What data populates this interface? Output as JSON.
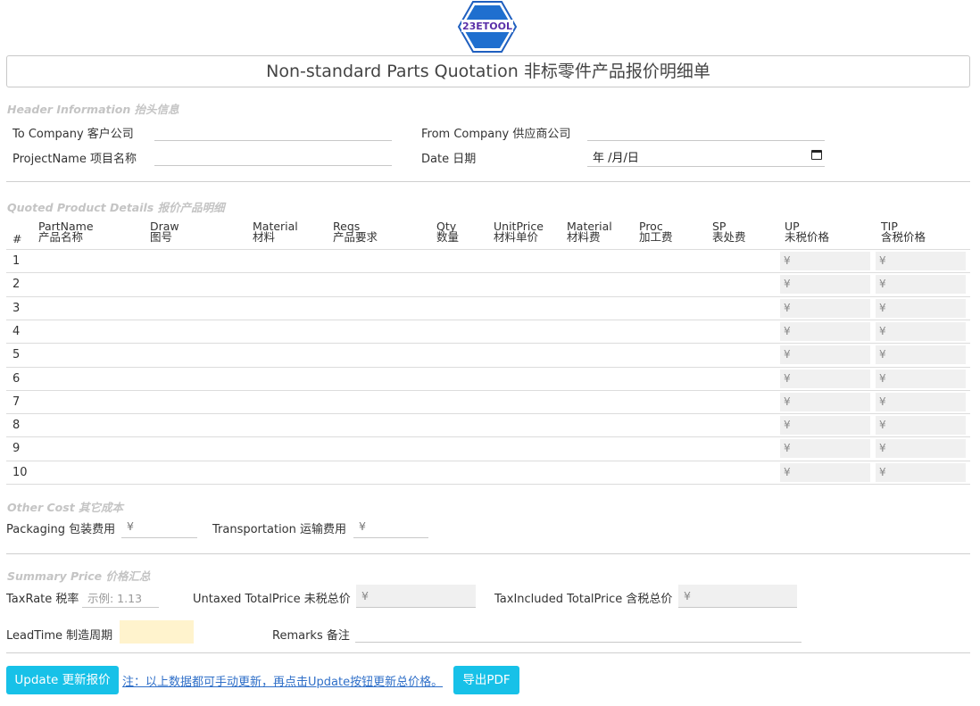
{
  "logo": {
    "text": "23ETOOL"
  },
  "title": "Non-standard Parts Quotation 非标零件产品报价明细单",
  "header_section": {
    "label": "Header Information 抬头信息",
    "to_company": "To Company 客户公司",
    "from_company": "From Company 供应商公司",
    "project_name": "ProjectName 项目名称",
    "date_label": "Date 日期",
    "date_value": "年 /月/日"
  },
  "details_section": {
    "label": "Quoted Product Details 报价产品明细",
    "columns": [
      {
        "en": "#",
        "zh": ""
      },
      {
        "en": "PartName",
        "zh": "产品名称"
      },
      {
        "en": "Draw",
        "zh": "图号"
      },
      {
        "en": "Material",
        "zh": "材料"
      },
      {
        "en": "Reqs",
        "zh": "产品要求"
      },
      {
        "en": "Qty",
        "zh": "数量"
      },
      {
        "en": "UnitPrice",
        "zh": "材料单价"
      },
      {
        "en": "Material",
        "zh": "材料费"
      },
      {
        "en": "Proc",
        "zh": "加工费"
      },
      {
        "en": "SP",
        "zh": "表处费"
      },
      {
        "en": "UP",
        "zh": "未税价格"
      },
      {
        "en": "TIP",
        "zh": "含税价格"
      }
    ],
    "rows": [
      "1",
      "2",
      "3",
      "4",
      "5",
      "6",
      "7",
      "8",
      "9",
      "10"
    ],
    "currency": "¥"
  },
  "other_cost": {
    "label": "Other Cost 其它成本",
    "packaging": "Packaging 包装费用",
    "packaging_value": "¥",
    "transportation": "Transportation 运输费用",
    "transportation_value": "¥"
  },
  "summary": {
    "label": "Summary Price 价格汇总",
    "tax_rate": "TaxRate 税率",
    "tax_rate_placeholder": "示例: 1.13",
    "untaxed_total": "Untaxed TotalPrice 未税总价",
    "untaxed_value": "¥",
    "tax_included_total": "TaxIncluded TotalPrice 含税总价",
    "tax_included_value": "¥",
    "lead_time": "LeadTime 制造周期",
    "remarks": "Remarks 备注"
  },
  "actions": {
    "update_button": "Update 更新报价",
    "note": "注：以上数据都可手动更新，再点击Update按钮更新总价格。",
    "export_button": "导出PDF"
  },
  "colors": {
    "button": "#17c1e8",
    "logo_blue": "#1f5fbf",
    "lead_time_bg": "#fff3cd",
    "readonly_bg": "#f0f0f0"
  }
}
